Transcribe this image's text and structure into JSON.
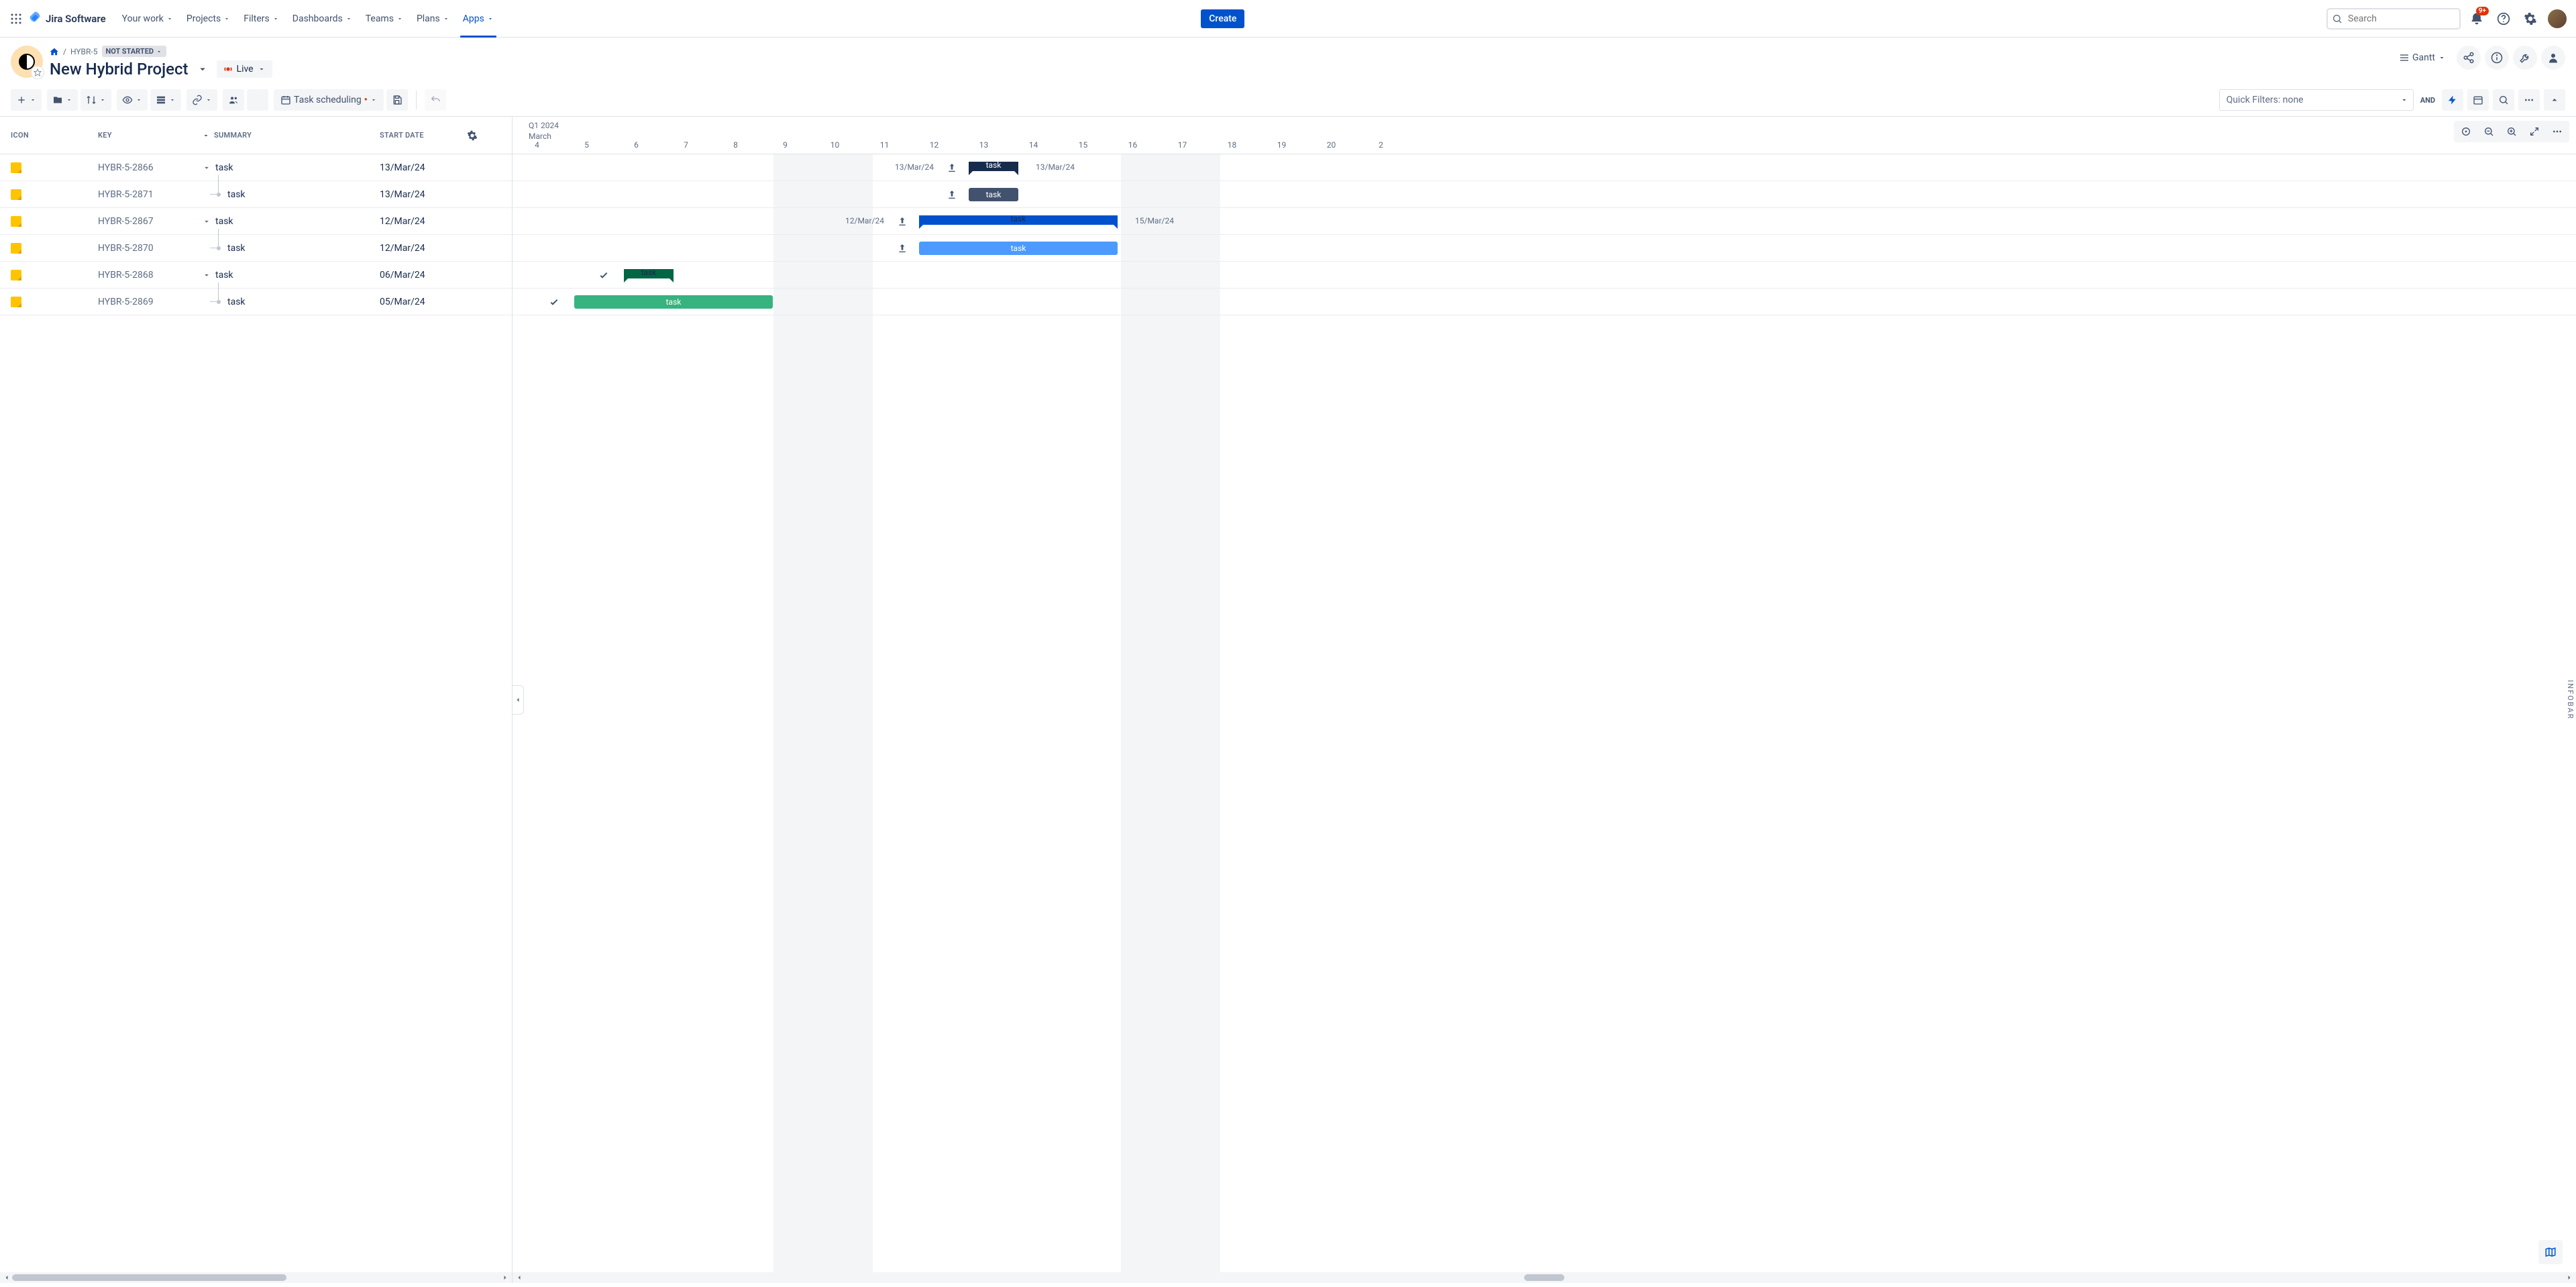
{
  "topnav": {
    "logo": "Jira Software",
    "items": [
      "Your work",
      "Projects",
      "Filters",
      "Dashboards",
      "Teams",
      "Plans",
      "Apps"
    ],
    "active_index": 6,
    "create": "Create",
    "search_placeholder": "Search",
    "notification_badge": "9+"
  },
  "project": {
    "breadcrumb_key": "HYBR-5",
    "status": "NOT STARTED",
    "title": "New Hybrid Project",
    "live": "Live",
    "view": "Gantt"
  },
  "toolbar": {
    "task_scheduling": "Task scheduling",
    "quick_filters": "Quick Filters: none",
    "and": "AND"
  },
  "columns": {
    "icon": "ICON",
    "key": "KEY",
    "summary": "SUMMARY",
    "start_date": "START DATE"
  },
  "tasks": [
    {
      "key": "HYBR-5-2866",
      "summary": "task",
      "date": "13/Mar/24",
      "level": 0
    },
    {
      "key": "HYBR-5-2871",
      "summary": "task",
      "date": "13/Mar/24",
      "level": 1
    },
    {
      "key": "HYBR-5-2867",
      "summary": "task",
      "date": "12/Mar/24",
      "level": 0
    },
    {
      "key": "HYBR-5-2870",
      "summary": "task",
      "date": "12/Mar/24",
      "level": 1
    },
    {
      "key": "HYBR-5-2868",
      "summary": "task",
      "date": "06/Mar/24",
      "level": 0
    },
    {
      "key": "HYBR-5-2869",
      "summary": "task",
      "date": "05/Mar/24",
      "level": 1
    }
  ],
  "timeline": {
    "quarter": "Q1 2024",
    "month": "March",
    "days": [
      "4",
      "5",
      "6",
      "7",
      "8",
      "9",
      "10",
      "11",
      "12",
      "13",
      "14",
      "15",
      "16",
      "17",
      "18",
      "19",
      "20",
      "2"
    ]
  },
  "bars": {
    "r0_left_date": "13/Mar/24",
    "r0_label": "task",
    "r0_right_date": "13/Mar/24",
    "r1_label": "task",
    "r2_left_date": "12/Mar/24",
    "r2_label": "task",
    "r2_right_date": "15/Mar/24",
    "r3_label": "task",
    "r4_label": "task",
    "r5_label": "task"
  },
  "infobar": "INFOBAR",
  "chart_data": {
    "type": "gantt",
    "time_axis": {
      "unit": "day",
      "start": "2024-03-04",
      "visible_end": "2024-03-20"
    },
    "tasks": [
      {
        "id": "HYBR-5-2866",
        "name": "task",
        "start": "2024-03-13",
        "end": "2024-03-13",
        "type": "summary",
        "color": "#172B4D",
        "status": "scheduled"
      },
      {
        "id": "HYBR-5-2871",
        "name": "task",
        "start": "2024-03-13",
        "end": "2024-03-13",
        "type": "task",
        "parent": "HYBR-5-2866",
        "color": "#42526E",
        "status": "scheduled"
      },
      {
        "id": "HYBR-5-2867",
        "name": "task",
        "start": "2024-03-12",
        "end": "2024-03-15",
        "type": "summary",
        "color": "#0052CC",
        "status": "scheduled"
      },
      {
        "id": "HYBR-5-2870",
        "name": "task",
        "start": "2024-03-12",
        "end": "2024-03-15",
        "type": "task",
        "parent": "HYBR-5-2867",
        "color": "#4C9AFF",
        "status": "scheduled"
      },
      {
        "id": "HYBR-5-2868",
        "name": "task",
        "start": "2024-03-06",
        "end": "2024-03-06",
        "type": "summary",
        "color": "#006644",
        "status": "done"
      },
      {
        "id": "HYBR-5-2869",
        "name": "task",
        "start": "2024-03-05",
        "end": "2024-03-08",
        "type": "task",
        "parent": "HYBR-5-2868",
        "color": "#36B37E",
        "status": "done"
      }
    ],
    "weekend_bands": [
      [
        "2024-03-09",
        "2024-03-10"
      ],
      [
        "2024-03-16",
        "2024-03-17"
      ]
    ]
  }
}
